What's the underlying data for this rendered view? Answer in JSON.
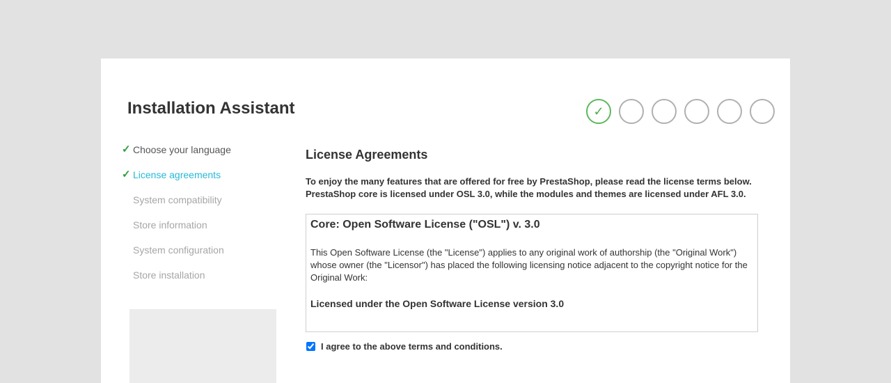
{
  "title": "Installation Assistant",
  "progress": {
    "steps_total": 6,
    "steps_completed": 1,
    "completed_icon": "checkmark-icon",
    "accent_color": "#5cb85c"
  },
  "sidebar": {
    "items": [
      {
        "label": "Choose your language",
        "state": "done"
      },
      {
        "label": "License agreements",
        "state": "active"
      },
      {
        "label": "System compatibility",
        "state": "pending"
      },
      {
        "label": "Store information",
        "state": "pending"
      },
      {
        "label": "System configuration",
        "state": "pending"
      },
      {
        "label": "Store installation",
        "state": "pending"
      }
    ],
    "check_icon": "checkmark-icon",
    "active_color": "#25b9d7"
  },
  "main": {
    "heading": "License Agreements",
    "intro_line1": "To enjoy the many features that are offered for free by PrestaShop, please read the license terms below.",
    "intro_line2": "PrestaShop core is licensed under OSL 3.0, while the modules and themes are licensed under AFL 3.0.",
    "license": {
      "heading": "Core: Open Software License (\"OSL\") v. 3.0",
      "body": "This Open Software License (the \"License\") applies to any original work of authorship (the \"Original Work\") whose owner (the \"Licensor\") has placed the following licensing notice adjacent to the copyright notice for the Original Work:",
      "subheading": "Licensed under the Open Software License version 3.0"
    },
    "agree": {
      "label": "I agree to the above terms and conditions.",
      "checked": true
    }
  }
}
